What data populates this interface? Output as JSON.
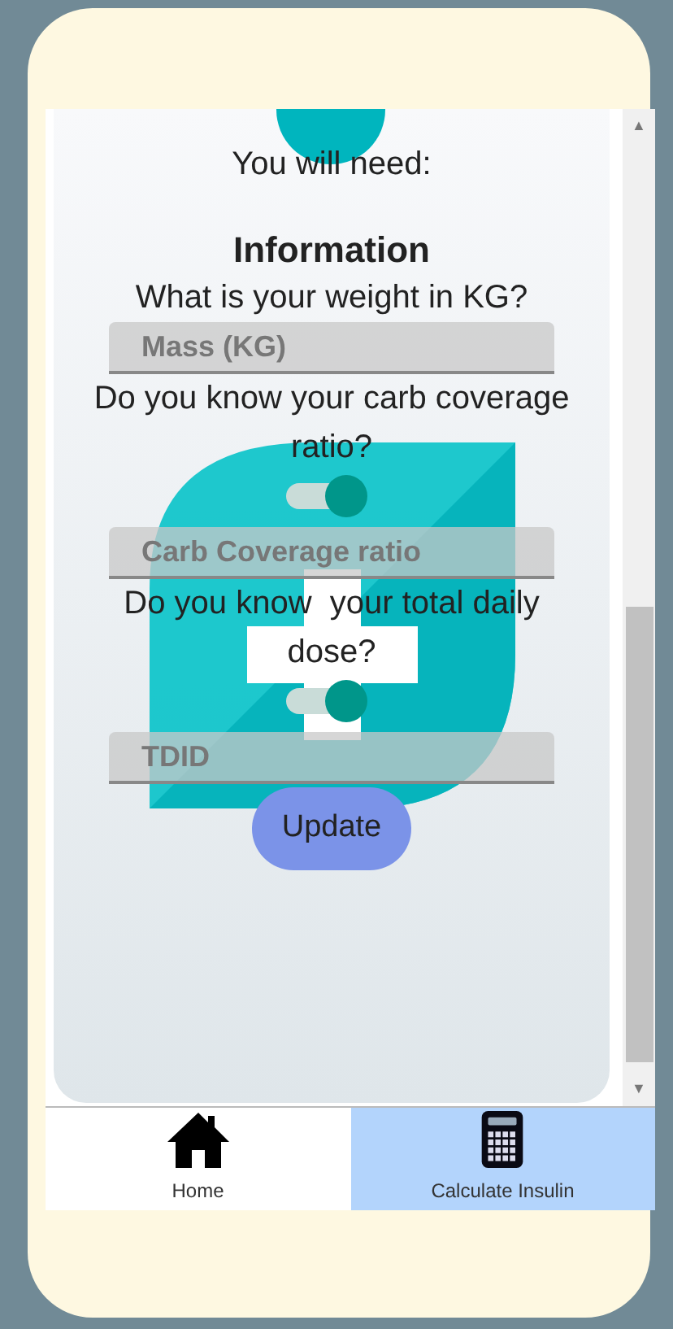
{
  "intro": "You will need:",
  "heading": "Information",
  "form": [
    {
      "kind": "question",
      "text": "What is your weight in KG?"
    },
    {
      "kind": "field",
      "placeholder": "Mass (KG)"
    },
    {
      "kind": "question",
      "text": "Do you know your carb coverage ratio?"
    },
    {
      "kind": "toggle",
      "on": true
    },
    {
      "kind": "field",
      "placeholder": "Carb Coverage ratio"
    },
    {
      "kind": "question",
      "text": "Do you know  your total daily dose?"
    },
    {
      "kind": "toggle",
      "on": true
    },
    {
      "kind": "field",
      "placeholder": "TDID"
    }
  ],
  "scroll_up": "▲",
  "scroll_down": "▼",
  "button": "Update",
  "tabs": [
    {
      "label": "Home",
      "selected": false
    },
    {
      "label": "Calculate Insulin",
      "selected": true
    }
  ]
}
